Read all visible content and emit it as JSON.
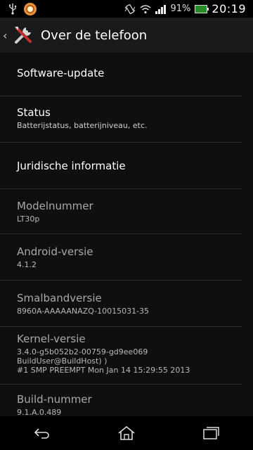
{
  "statusbar": {
    "battery_percent": "91%",
    "time": "20:19"
  },
  "actionbar": {
    "title": "Over de telefoon",
    "icon": "tools-icon"
  },
  "items": [
    {
      "title": "Software-update",
      "sub": ""
    },
    {
      "title": "Status",
      "sub": "Batterijstatus, batterijniveau, etc."
    },
    {
      "title": "Juridische informatie",
      "sub": ""
    },
    {
      "title": "Modelnummer",
      "sub": "LT30p"
    },
    {
      "title": "Android-versie",
      "sub": "4.1.2"
    },
    {
      "title": "Smalbandversie",
      "sub": "8960A-AAAAANAZQ-10015031-35"
    },
    {
      "title": "Kernel-versie",
      "sub1": "3.4.0-g5b052b2-00759-gd9ee069",
      "sub2": "BuildUser@BuildHost) )",
      "sub3": "#1 SMP PREEMPT Mon Jan 14 15:29:55 2013"
    },
    {
      "title": "Build-nummer",
      "sub": "9.1.A.0.489"
    }
  ],
  "colors": {
    "background": "#0f0f0f",
    "actionbar": "#1a1a1a",
    "divider": "#2c2c2c",
    "disabled_text": "#a8a8a8"
  }
}
